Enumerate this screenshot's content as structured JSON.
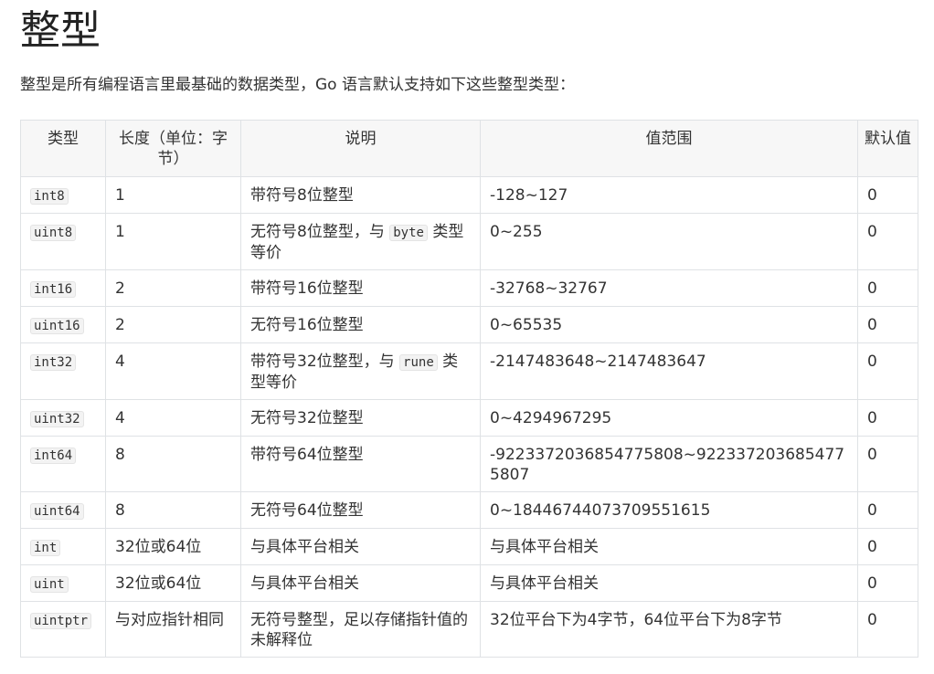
{
  "page": {
    "title": "整型",
    "intro": "整型是所有编程语言里最基础的数据类型，Go 语言默认支持如下这些整型类型："
  },
  "table": {
    "headers": {
      "type": "类型",
      "length": "长度（单位：字节）",
      "desc": "说明",
      "range": "值范围",
      "default": "默认值"
    },
    "rows": [
      {
        "type": "int8",
        "length": "1",
        "desc": "带符号8位整型",
        "range": "-128~127",
        "default": "0"
      },
      {
        "type": "uint8",
        "length": "1",
        "desc_before": "无符号8位整型，与 ",
        "desc_code": "byte",
        "desc_after": " 类型等价",
        "range": "0~255",
        "default": "0"
      },
      {
        "type": "int16",
        "length": "2",
        "desc": "带符号16位整型",
        "range": "-32768~32767",
        "default": "0"
      },
      {
        "type": "uint16",
        "length": "2",
        "desc": "无符号16位整型",
        "range": "0~65535",
        "default": "0"
      },
      {
        "type": "int32",
        "length": "4",
        "desc_before": "带符号32位整型，与 ",
        "desc_code": "rune",
        "desc_after": " 类型等价",
        "range": "-2147483648~2147483647",
        "default": "0"
      },
      {
        "type": "uint32",
        "length": "4",
        "desc": "无符号32位整型",
        "range": "0~4294967295",
        "default": "0"
      },
      {
        "type": "int64",
        "length": "8",
        "desc": "带符号64位整型",
        "range": "-9223372036854775808~9223372036854775807",
        "default": "0"
      },
      {
        "type": "uint64",
        "length": "8",
        "desc": "无符号64位整型",
        "range": "0~18446744073709551615",
        "default": "0"
      },
      {
        "type": "int",
        "length": "32位或64位",
        "desc": "与具体平台相关",
        "range": "与具体平台相关",
        "default": "0"
      },
      {
        "type": "uint",
        "length": "32位或64位",
        "desc": "与具体平台相关",
        "range": "与具体平台相关",
        "default": "0"
      },
      {
        "type": "uintptr",
        "length": "与对应指针相同",
        "desc": "无符号整型，足以存储指针值的未解释位",
        "range": "32位平台下为4字节，64位平台下为8字节",
        "default": "0"
      }
    ]
  }
}
